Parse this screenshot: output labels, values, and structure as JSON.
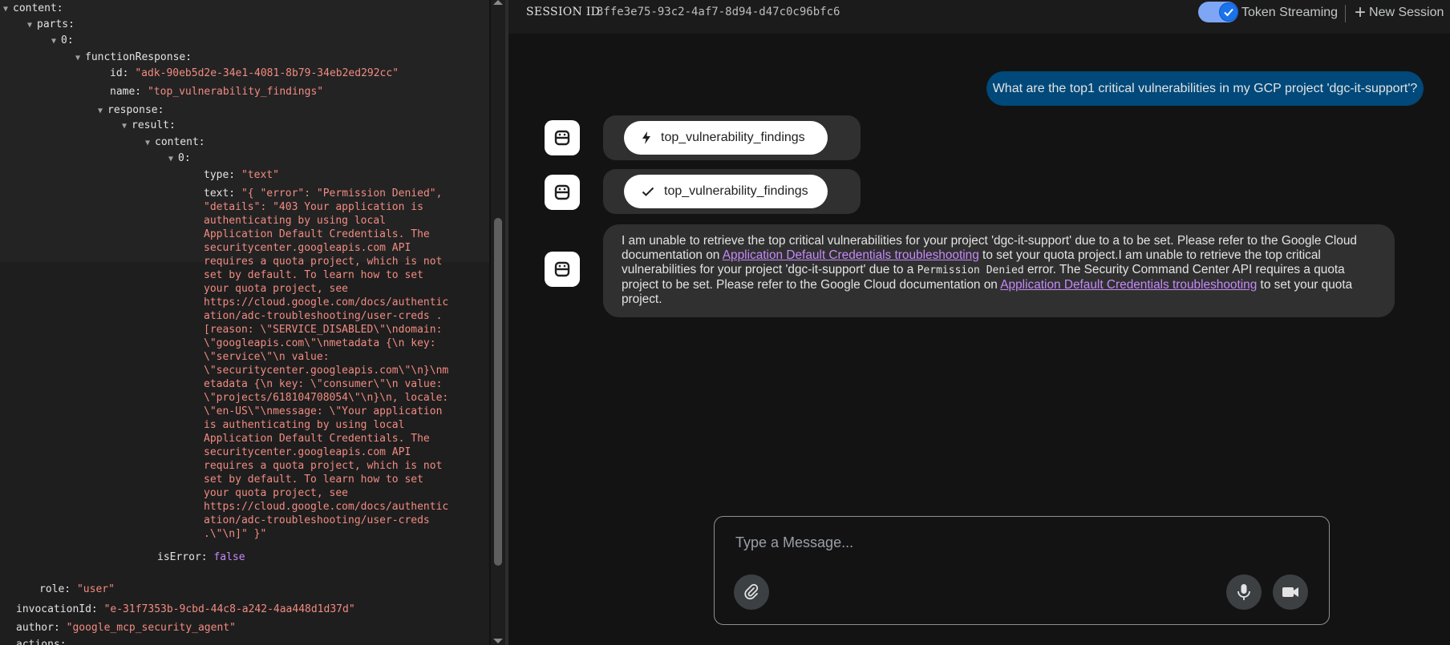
{
  "json_panel": {
    "lines": [
      {
        "key": "content:",
        "arrow": true,
        "value": "",
        "type": ""
      },
      {
        "key": "parts:",
        "arrow": true,
        "value": "",
        "type": ""
      },
      {
        "key": "0:",
        "arrow": true,
        "value": "",
        "type": ""
      },
      {
        "key": "functionResponse:",
        "arrow": true,
        "value": "",
        "type": ""
      },
      {
        "key": "id:",
        "arrow": false,
        "value": "\"adk-90eb5d2e-34e1-4081-8b79-34eb2ed292cc\"",
        "type": "str"
      },
      {
        "key": "name:",
        "arrow": false,
        "value": "\"top_vulnerability_findings\"",
        "type": "str"
      },
      {
        "key": "response:",
        "arrow": true,
        "value": "",
        "type": ""
      },
      {
        "key": "result:",
        "arrow": true,
        "value": "",
        "type": ""
      },
      {
        "key": "content:",
        "arrow": true,
        "value": "",
        "type": ""
      },
      {
        "key": "0:",
        "arrow": true,
        "value": "",
        "type": ""
      },
      {
        "key": "type:",
        "arrow": false,
        "value": "\"text\"",
        "type": "str"
      },
      {
        "key": "text:",
        "arrow": false,
        "value": "\"{ \"error\": \"Permission Denied\",",
        "type": "str"
      },
      {
        "key": "isError:",
        "arrow": false,
        "value": "false",
        "type": "bool"
      },
      {
        "key": "role:",
        "arrow": false,
        "value": "\"user\"",
        "type": "str"
      },
      {
        "key": "invocationId:",
        "arrow": false,
        "value": "\"e-31f7353b-9cbd-44c8-a242-4aa448d1d37d\"",
        "type": "str"
      },
      {
        "key": "author:",
        "arrow": false,
        "value": "\"google_mcp_security_agent\"",
        "type": "str"
      },
      {
        "key": "actions:",
        "arrow": false,
        "value": "",
        "type": ""
      }
    ],
    "text_continuation": "\"details\": \"403 Your application is\nauthenticating by using local\nApplication Default Credentials. The\nsecuritycenter.googleapis.com API\nrequires a quota project, which is not\nset by default. To learn how to set\nyour quota project, see\nhttps://cloud.google.com/docs/authentic\nation/adc-troubleshooting/user-creds .\n[reason: \\\"SERVICE_DISABLED\\\"\\ndomain:\n\\\"googleapis.com\\\"\\nmetadata {\\n key:\n\\\"service\\\"\\n value:\n\\\"securitycenter.googleapis.com\\\"\\n}\\nm\netadata {\\n key: \\\"consumer\\\"\\n value:\n\\\"projects/618104708054\\\"\\n}\\n, locale:\n\\\"en-US\\\"\\nmessage: \\\"Your application\nis authenticating by using local\nApplication Default Credentials. The\nsecuritycenter.googleapis.com API\nrequires a quota project, which is not\nset by default. To learn how to set\nyour quota project, see\nhttps://cloud.google.com/docs/authentic\nation/adc-troubleshooting/user-creds\n.\\\"\\n]\" }\""
  },
  "header": {
    "session_label": "SESSION ID",
    "session_id": "3ffe3e75-93c2-4af7-8d94-d47c0c96bfc6",
    "token_streaming_label": "Token Streaming",
    "token_streaming_on": true,
    "new_session_label": "New Session"
  },
  "chat": {
    "user_message": "What are the top1 critical vulnerabilities in my GCP project 'dgc-it-support'?",
    "function_call": "top_vulnerability_findings",
    "function_response": "top_vulnerability_findings",
    "response": {
      "p1": "I am unable to retrieve the top critical vulnerabilities for your project 'dgc-it-support' due to a to be set. Please refer to the Google Cloud documentation on ",
      "link1": "Application Default Credentials troubleshooting",
      "p2": " to set your quota project.I am unable to retrieve the top critical vulnerabilities for your project 'dgc-it-support' due to a ",
      "code": "Permission Denied",
      "p3": " error. The Security Command Center API requires a quota project to be set. Please refer to the Google Cloud documentation on ",
      "link2": "Application Default Credentials troubleshooting",
      "p4": " to set your quota project."
    }
  },
  "composer": {
    "placeholder": "Type a Message..."
  },
  "colors": {
    "user_bubble": "#00497a",
    "string_value": "#f28b82",
    "bool_value": "#c58af9",
    "link": "#c58af9",
    "toggle_on": "#1a73e8"
  }
}
